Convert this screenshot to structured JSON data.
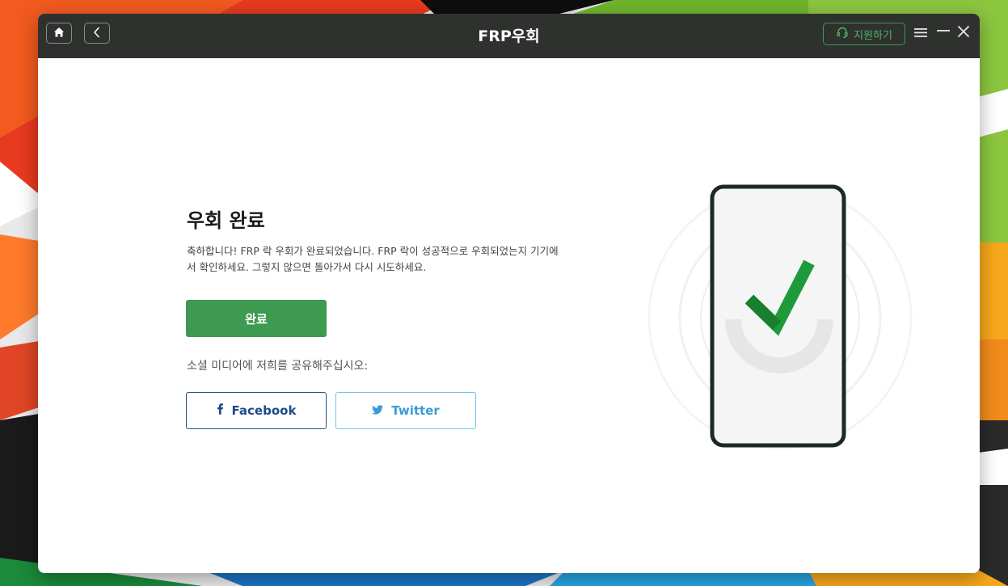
{
  "window": {
    "title": "FRP우회",
    "support_label": "지원하기"
  },
  "icons": {
    "home": "home-icon",
    "back": "chevron-left-icon",
    "support": "headset-icon",
    "menu": "hamburger-menu-icon",
    "minimize": "minimize-icon",
    "close": "close-icon",
    "facebook": "facebook-icon",
    "twitter": "twitter-icon",
    "illustration": "phone-checkmark-illustration"
  },
  "content": {
    "heading": "우회 완료",
    "description": "축하합니다! FRP 락 우회가 완료되었습니다. FRP 락이 성공적으로 우회되었는지 기기에서 확인하세요. 그렇지 않으면 돌아가서 다시 시도하세요.",
    "done_button": "완료",
    "share_label": "소셜 미디어에 저희를 공유해주십시오:",
    "facebook_label": "Facebook",
    "twitter_label": "Twitter"
  },
  "colors": {
    "titlebar": "#2f312f",
    "accent_green": "#3d9a50",
    "facebook_blue": "#1e4a86",
    "twitter_blue": "#3a9bd9"
  }
}
